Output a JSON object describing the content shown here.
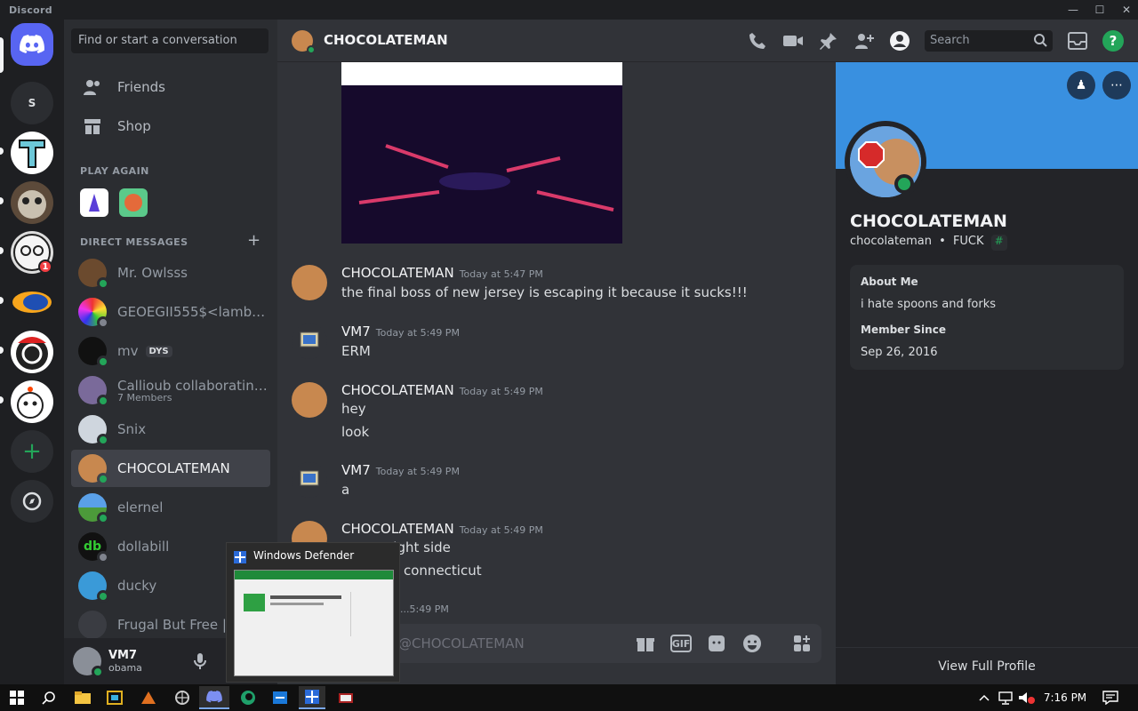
{
  "app": {
    "title": "Discord"
  },
  "window": {
    "minimize": "—",
    "maximize": "☐",
    "close": "✕"
  },
  "guilds": [
    {
      "label": "S"
    }
  ],
  "guild_badge": "1",
  "sidebar": {
    "search_placeholder": "Find or start a conversation",
    "friends": "Friends",
    "shop": "Shop",
    "play_again": "PLAY AGAIN",
    "direct_messages": "DIRECT MESSAGES",
    "dms": [
      {
        "name": "Mr. Owlsss"
      },
      {
        "name": "GEOEGII555$<lambd..."
      },
      {
        "name": "mv",
        "tag": "DYS"
      },
      {
        "name": "Callioub collaborating...",
        "sub": "7 Members"
      },
      {
        "name": "Snix"
      },
      {
        "name": "CHOCOLATEMAN"
      },
      {
        "name": "elernel"
      },
      {
        "name": "dollabill"
      },
      {
        "name": "ducky"
      },
      {
        "name": "Frugal But Free | U..."
      }
    ]
  },
  "user": {
    "name": "VM7",
    "status": "obama"
  },
  "chat": {
    "title": "CHOCOLATEMAN",
    "search_placeholder": "Search",
    "input_placeholder": "@CHOCOLATEMAN",
    "gif": "GIF",
    "messages": [
      {
        "author": "CHOCOLATEMAN",
        "time": "Today at 5:47 PM",
        "lines": [
          "the final boss of new jersey is escaping it because it sucks!!!"
        ]
      },
      {
        "author": "VM7",
        "time": "Today at 5:49 PM",
        "lines": [
          "ERM"
        ]
      },
      {
        "author": "CHOCOLATEMAN",
        "time": "Today at 5:49 PM",
        "lines": [
          "hey",
          "look"
        ]
      },
      {
        "author": "VM7",
        "time": "Today at 5:49 PM",
        "lines": [
          "a"
        ]
      },
      {
        "author": "CHOCOLATEMAN",
        "time": "Today at 5:49 PM",
        "lines": [
          "...ight side",
          "connecticut"
        ]
      },
      {
        "author": "",
        "time": "...5:49 PM",
        "lines": []
      }
    ]
  },
  "profile": {
    "display_name": "CHOCOLATEMAN",
    "username": "chocolateman",
    "separator": "•",
    "custom": "FUCK",
    "about_label": "About Me",
    "about": "i hate spoons and forks",
    "member_since_label": "Member Since",
    "member_since": "Sep 26, 2016",
    "view_full": "View Full Profile"
  },
  "taskbar": {
    "preview_title": "Windows Defender",
    "time": "7:16 PM"
  },
  "colors": {
    "blurple": "#5865f2",
    "online": "#23a559",
    "banner": "#3990e0"
  }
}
